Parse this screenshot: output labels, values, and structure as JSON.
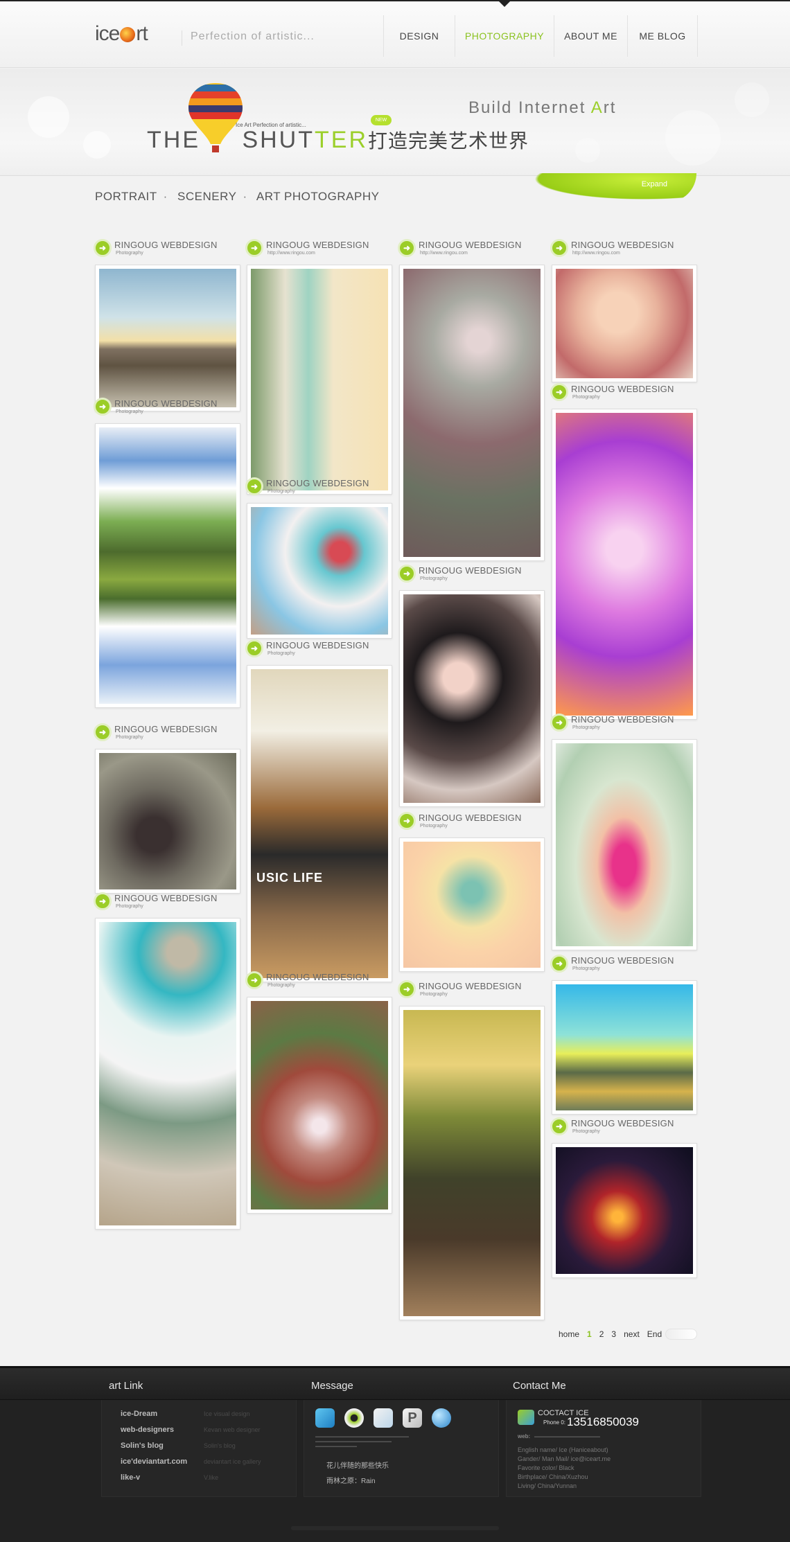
{
  "brand": {
    "logo_pre": "ice",
    "logo_post": "rt",
    "tagline": "Perfection  of  artistic..."
  },
  "nav": [
    {
      "label": "DESIGN",
      "active": false
    },
    {
      "label": "PHOTOGRAPHY",
      "active": true
    },
    {
      "label": "ABOUT ME",
      "active": false
    },
    {
      "label": "ME BLOG",
      "active": false
    }
  ],
  "banner": {
    "the": "THE ",
    "shut": "SHUT",
    "ter": "TER",
    "cn": "打造完美艺术世界",
    "small_tag": "Ice Art Perfection of artistic...",
    "new_badge": "NEW",
    "bia_1": "Build  Internet  ",
    "bia_a": "A",
    "bia_2": "rt",
    "expand_label": "Expand"
  },
  "categories": [
    "PORTRAIT",
    "SCENERY",
    "ART PHOTOGRAPHY"
  ],
  "card_title": "RINGOUG WEBDESIGN",
  "cards": [
    {
      "sub": "Photography",
      "caption": ""
    },
    {
      "sub": "Photography",
      "caption": ""
    },
    {
      "sub": "Photography",
      "caption": ""
    },
    {
      "sub": "Photography",
      "caption": ""
    },
    {
      "sub": "http://www.ringou.com",
      "caption": ""
    },
    {
      "sub": "Photography",
      "caption": ""
    },
    {
      "sub": "Photography",
      "caption": "USIC LIFE"
    },
    {
      "sub": "Photography",
      "caption": ""
    },
    {
      "sub": "http://www.ringou.com",
      "caption": ""
    },
    {
      "sub": "Photography",
      "caption": ""
    },
    {
      "sub": "Photography",
      "caption": ""
    },
    {
      "sub": "Photography",
      "caption": ""
    },
    {
      "sub": "http://www.ringou.com",
      "caption": ""
    },
    {
      "sub": "Photography",
      "caption": ""
    },
    {
      "sub": "Photography",
      "caption": ""
    },
    {
      "sub": "Photography",
      "caption": ""
    },
    {
      "sub": "Photography",
      "caption": ""
    }
  ],
  "pagination": {
    "home": "home",
    "pages": [
      "1",
      "2",
      "3"
    ],
    "current": "1",
    "next": "next",
    "end": "End"
  },
  "footer": {
    "links_title": "art Link",
    "message_title": "Message",
    "contact_title": "Contact Me",
    "links": [
      {
        "name": "ice-Dream",
        "desc": "Ice visual design"
      },
      {
        "name": "web-designers",
        "desc": "Kevan web designer"
      },
      {
        "name": "Solin's blog",
        "desc": "Solin's blog"
      },
      {
        "name": "ice'deviantart.com",
        "desc": "deviantart ice gallery"
      },
      {
        "name": "like-v",
        "desc": "V.like"
      }
    ],
    "message_lines": [
      "花儿伴随的那些快乐",
      "雨林之原：Rain"
    ],
    "contact_label": "COCTACT ICE",
    "phone_label": "Phone 0:",
    "phone": "13516850039",
    "web_label": "web:",
    "info": [
      "English name/ Ice (Haniceabout)",
      "Gander/ Man       Mail/ ice@iceart.me",
      "Favorite color/ Black",
      "Birthplace/ China/Xuzhou",
      "Living/ China/Yunnan"
    ]
  },
  "colors": {
    "accent": "#8bc220",
    "footer_bg": "#222222",
    "page_bg": "#f2f2f2"
  }
}
